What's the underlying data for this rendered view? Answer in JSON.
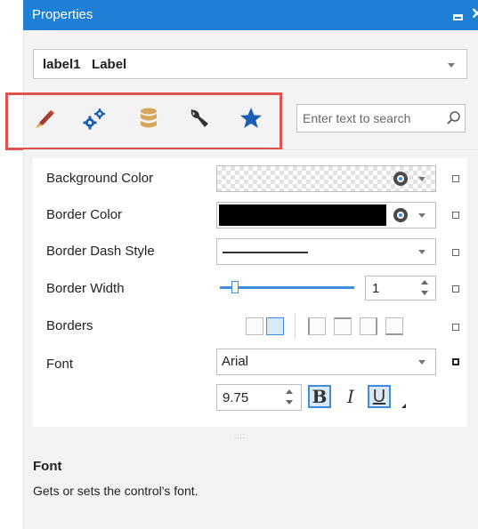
{
  "window": {
    "title": "Properties"
  },
  "object_selector": {
    "value": "label1   Label"
  },
  "tabs": [
    {
      "name": "appearance",
      "icon": "paintbrush-icon"
    },
    {
      "name": "behavior",
      "icon": "gears-icon"
    },
    {
      "name": "data",
      "icon": "database-icon"
    },
    {
      "name": "design",
      "icon": "wrench-icon"
    },
    {
      "name": "favorites",
      "icon": "star-icon"
    }
  ],
  "search": {
    "placeholder": "Enter text to search"
  },
  "properties": {
    "background_color": {
      "label": "Background Color"
    },
    "border_color": {
      "label": "Border Color",
      "value_color": "#000000"
    },
    "border_dash_style": {
      "label": "Border Dash Style"
    },
    "border_width": {
      "label": "Border Width",
      "value": "1",
      "slider_fraction": 0.1
    },
    "borders": {
      "label": "Borders"
    },
    "font": {
      "label": "Font",
      "family": "Arial",
      "size": "9.75",
      "bold_label": "B",
      "italic_label": "I",
      "underline_label": "U"
    }
  },
  "splitter": {
    "grip": "::::"
  },
  "description": {
    "title": "Font",
    "text": "Gets or sets the control's font."
  },
  "colors": {
    "accent": "#1e7fd4",
    "highlight": "#e0524e",
    "star": "#1a5fb4",
    "db": "#d9a55a"
  }
}
